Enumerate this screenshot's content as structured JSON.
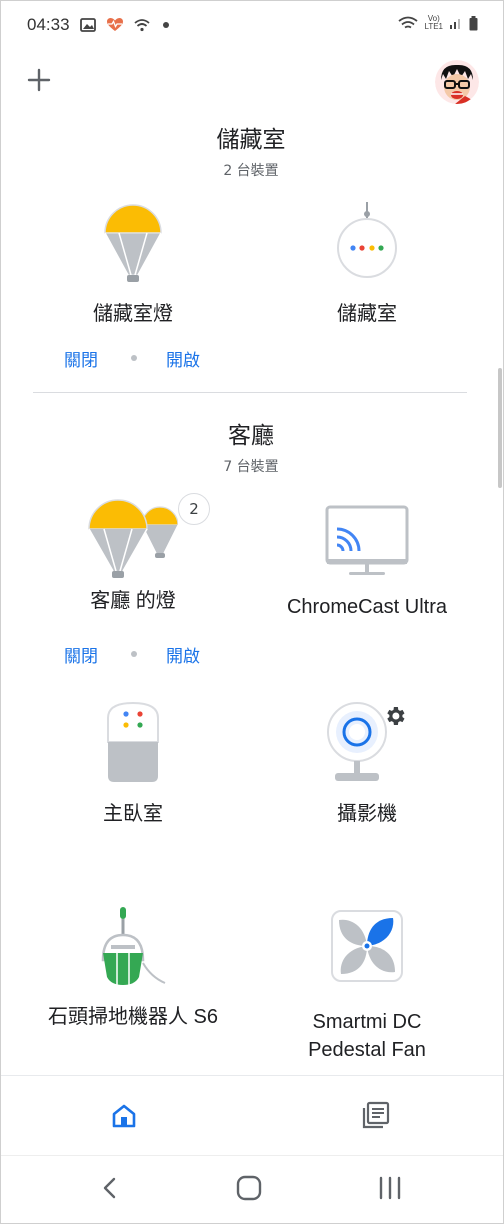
{
  "status_bar": {
    "time": "04:33",
    "network_label_top": "Vo)",
    "network_label_bottom": "LTE1"
  },
  "rooms": [
    {
      "name": "儲藏室",
      "count": "2 台裝置",
      "devices": [
        {
          "label": "儲藏室燈",
          "icon": "light-bulb-icon"
        },
        {
          "label": "儲藏室",
          "icon": "smart-speaker-mini-icon"
        }
      ],
      "controls": {
        "off": "關閉",
        "on": "開啟"
      }
    },
    {
      "name": "客廳",
      "count": "7 台裝置",
      "devices": [
        {
          "label": "客廳 的燈",
          "icon": "light-group-icon",
          "badge": "2"
        },
        {
          "label": "ChromeCast Ultra",
          "icon": "chromecast-tv-icon"
        },
        {
          "label": "主臥室",
          "icon": "smart-speaker-icon"
        },
        {
          "label": "攝影機",
          "icon": "camera-icon"
        },
        {
          "label": "石頭掃地機器人 S6",
          "icon": "vacuum-icon"
        },
        {
          "label": "Smartmi DC Pedestal Fan",
          "label_line1": "Smartmi DC",
          "label_line2": "Pedestal Fan",
          "icon": "fan-icon"
        }
      ],
      "controls": {
        "off": "關閉",
        "on": "開啟"
      }
    }
  ],
  "bottom_nav": {
    "items": [
      "home-icon",
      "feed-icon"
    ],
    "active": "home-icon"
  },
  "colors": {
    "accent": "#1a73e8",
    "bulb": "#fbbc04",
    "gray": "#bdc1c6",
    "green": "#34a853"
  }
}
